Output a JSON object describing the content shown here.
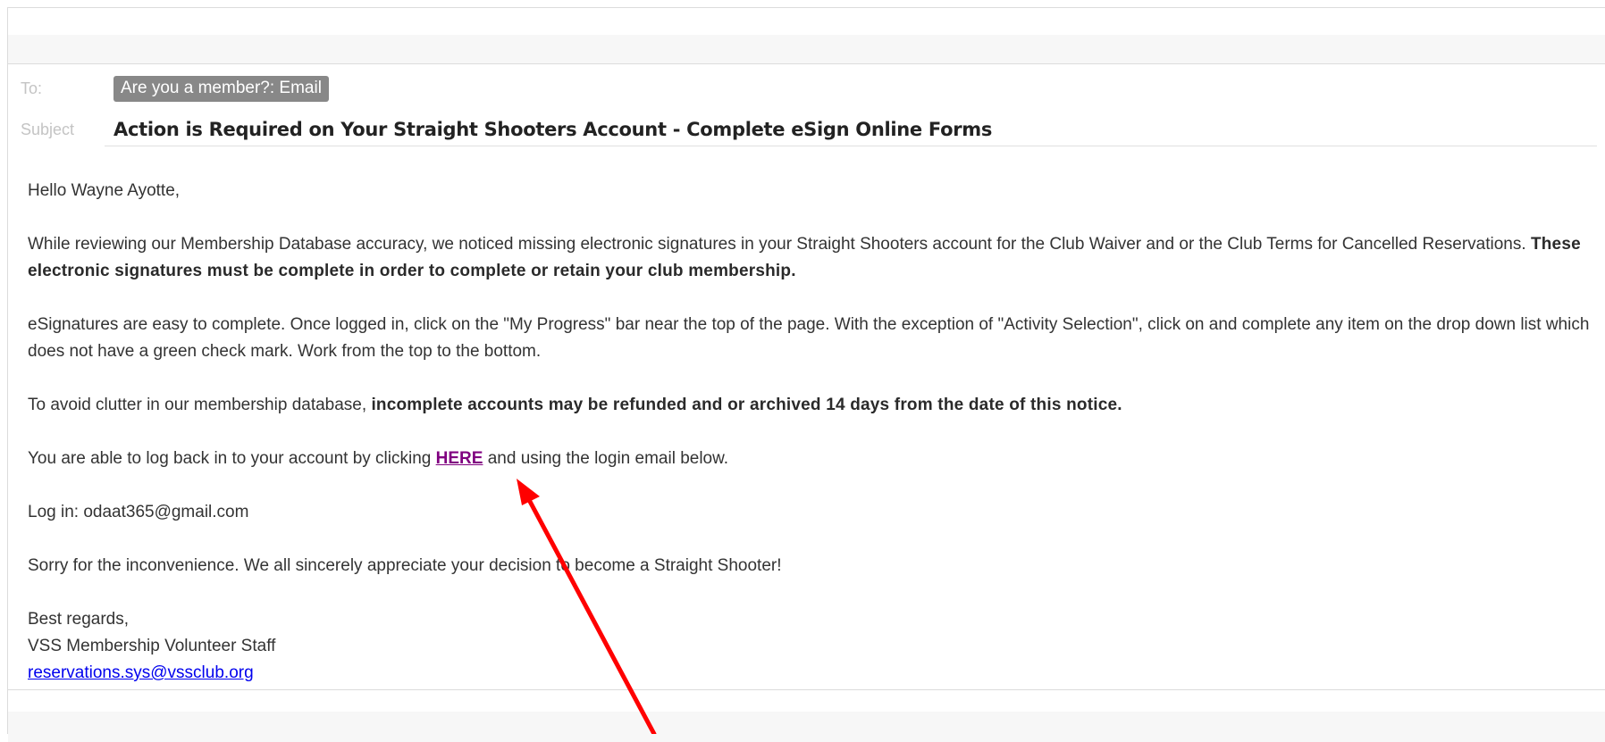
{
  "header": {
    "to_label": "To:",
    "to_recipient": "Are you a member?: Email",
    "subject_label": "Subject",
    "subject": "Action is Required on Your Straight Shooters Account - Complete eSign Online Forms"
  },
  "body": {
    "greeting": "Hello Wayne Ayotte,",
    "para1_text": "While reviewing our Membership Database accuracy, we noticed missing electronic signatures in your Straight Shooters account for the Club Waiver and or the Club Terms for Cancelled Reservations. ",
    "para1_bold": "These electronic signatures must be complete in order to complete or retain your club membership.",
    "para2": "eSignatures are easy to complete. Once logged in, click on the \"My Progress\" bar near the top of the page. With the exception of \"Activity Selection\", click on and complete any item on the drop down list which does not have a green check mark. Work from the top to the bottom.",
    "para3_text": "To avoid clutter in our membership database, ",
    "para3_bold": "incomplete accounts may be refunded and or archived 14 days from the date of this notice.",
    "para4_before": "You are able to log back in to your account by clicking ",
    "para4_link": "HERE",
    "para4_after": " and using the login email below.",
    "login": "Log in: odaat365@gmail.com",
    "apology": "Sorry for the inconvenience. We all sincerely appreciate your decision to become a Straight Shooter!",
    "signoff": "Best regards,",
    "signature": "VSS Membership Volunteer Staff",
    "email_link": "reservations.sys@vssclub.org"
  },
  "colors": {
    "link_visited": "#800080",
    "link": "#0000ee",
    "annotation_arrow": "#ff0000",
    "chip_bg": "#888888"
  }
}
